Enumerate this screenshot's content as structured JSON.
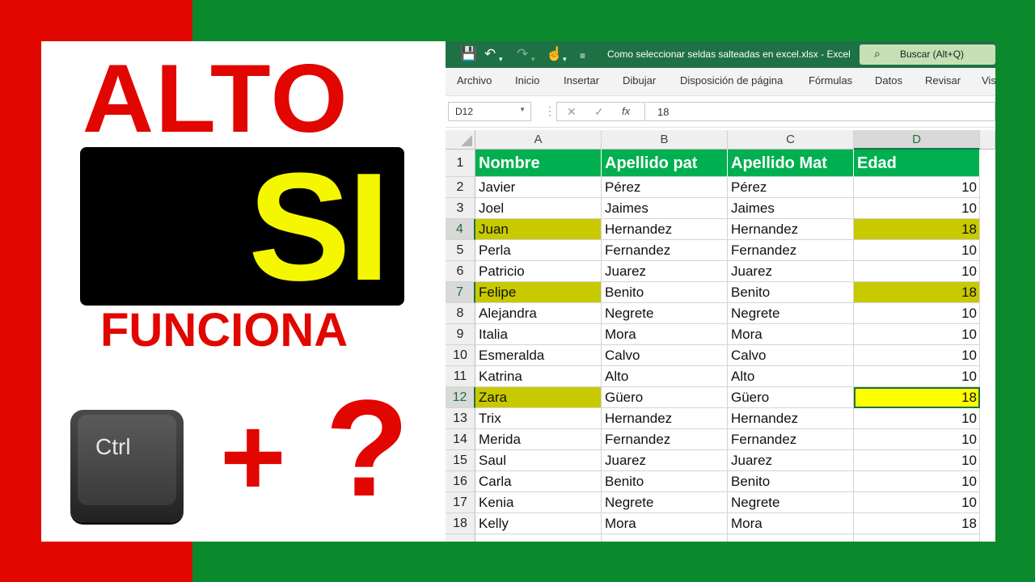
{
  "thumbnail": {
    "headline_top": "ALTO",
    "headline_big": "SI",
    "headline_bottom": "FUNCIONA",
    "key_label": "Ctrl",
    "plus_symbol": "+",
    "question_symbol": "?"
  },
  "excel": {
    "window_title": "Como seleccionar seldas salteadas en excel.xlsx  -  Excel",
    "search_placeholder": "Buscar (Alt+Q)",
    "ribbon_tabs": [
      "Archivo",
      "Inicio",
      "Insertar",
      "Dibujar",
      "Disposición de página",
      "Fórmulas",
      "Datos",
      "Revisar",
      "Vis"
    ],
    "name_box": "D12",
    "formula_value": "18",
    "fx_label": "fx",
    "columns": [
      "A",
      "B",
      "C",
      "D"
    ],
    "header_row": [
      "Nombre",
      "Apellido pat",
      "Apellido Mat",
      "Edad"
    ],
    "rows": [
      {
        "num": "2",
        "nombre": "Javier",
        "ap_pat": "Pérez",
        "ap_mat": "Pérez",
        "edad": "10"
      },
      {
        "num": "3",
        "nombre": "Joel",
        "ap_pat": "Jaimes",
        "ap_mat": "Jaimes",
        "edad": "10"
      },
      {
        "num": "4",
        "nombre": "Juan",
        "ap_pat": "Hernandez",
        "ap_mat": "Hernandez",
        "edad": "18"
      },
      {
        "num": "5",
        "nombre": "Perla",
        "ap_pat": "Fernandez",
        "ap_mat": "Fernandez",
        "edad": "10"
      },
      {
        "num": "6",
        "nombre": "Patricio",
        "ap_pat": "Juarez",
        "ap_mat": "Juarez",
        "edad": "10"
      },
      {
        "num": "7",
        "nombre": "Felipe",
        "ap_pat": "Benito",
        "ap_mat": "Benito",
        "edad": "18"
      },
      {
        "num": "8",
        "nombre": "Alejandra",
        "ap_pat": "Negrete",
        "ap_mat": "Negrete",
        "edad": "10"
      },
      {
        "num": "9",
        "nombre": "Italia",
        "ap_pat": "Mora",
        "ap_mat": "Mora",
        "edad": "10"
      },
      {
        "num": "10",
        "nombre": "Esmeralda",
        "ap_pat": "Calvo",
        "ap_mat": "Calvo",
        "edad": "10"
      },
      {
        "num": "11",
        "nombre": "Katrina",
        "ap_pat": "Alto",
        "ap_mat": "Alto",
        "edad": "10"
      },
      {
        "num": "12",
        "nombre": "Zara",
        "ap_pat": "Güero",
        "ap_mat": "Güero",
        "edad": "18"
      },
      {
        "num": "13",
        "nombre": "Trix",
        "ap_pat": "Hernandez",
        "ap_mat": "Hernandez",
        "edad": "10"
      },
      {
        "num": "14",
        "nombre": "Merida",
        "ap_pat": "Fernandez",
        "ap_mat": "Fernandez",
        "edad": "10"
      },
      {
        "num": "15",
        "nombre": "Saul",
        "ap_pat": "Juarez",
        "ap_mat": "Juarez",
        "edad": "10"
      },
      {
        "num": "16",
        "nombre": "Carla",
        "ap_pat": "Benito",
        "ap_mat": "Benito",
        "edad": "10"
      },
      {
        "num": "17",
        "nombre": "Kenia",
        "ap_pat": "Negrete",
        "ap_mat": "Negrete",
        "edad": "10"
      },
      {
        "num": "18",
        "nombre": "Kelly",
        "ap_pat": "Mora",
        "ap_mat": "Mora",
        "edad": "18"
      }
    ],
    "highlighted_rows": [
      "4",
      "7",
      "12"
    ],
    "active_cell": "D12",
    "colors": {
      "titlebar": "#1e7145",
      "header_fill": "#00b050",
      "selection_fill": "#c9c900",
      "active_fill": "#ffff00"
    }
  }
}
